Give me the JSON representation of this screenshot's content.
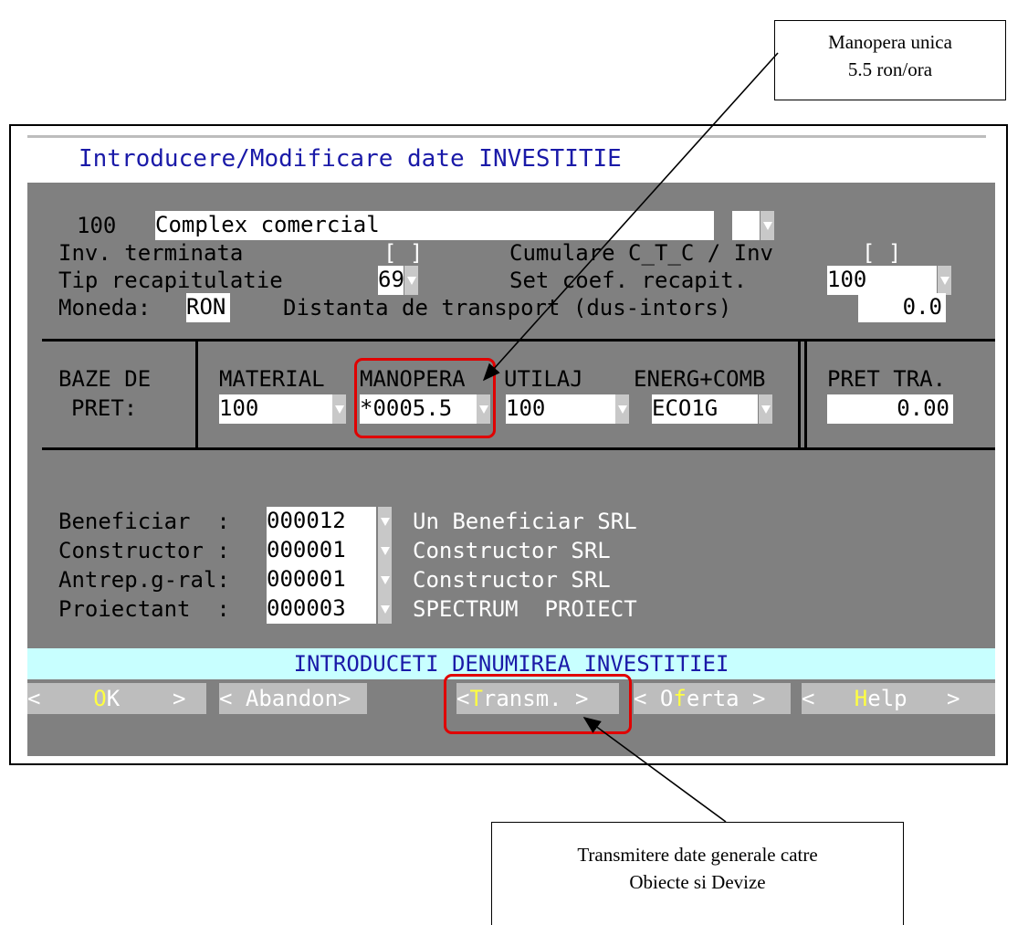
{
  "callouts": {
    "top": {
      "line1": "Manopera unica",
      "line2": "5.5 ron/ora"
    },
    "bottom": {
      "line1": "Transmitere date generale catre",
      "line2": "Obiecte si Devize"
    }
  },
  "window": {
    "title": "Introducere/Modificare date INVESTITIE",
    "investment": {
      "code": "100",
      "name": "Complex comercial"
    },
    "labels": {
      "inv_terminata": "Inv. terminata",
      "cumulare": "Cumulare C_T_C / Inv",
      "tip_recap": "Tip recapitulatie",
      "set_coef": "Set coef. recapit.",
      "moneda": "Moneda:",
      "distanta": "Distanta de transport (dus-intors)"
    },
    "values": {
      "inv_terminata": "[ ]",
      "cumulare": "[ ]",
      "tip_recap": "69",
      "set_coef": "100",
      "moneda": "RON",
      "distanta": "0.0"
    },
    "price_bases": {
      "label_line1": "BAZE DE",
      "label_line2": "PRET:",
      "material": {
        "header": "MATERIAL",
        "value": "100"
      },
      "manopera": {
        "header": "MANOPERA",
        "value": "*0005.5"
      },
      "utilaj": {
        "header": "UTILAJ",
        "value": "100"
      },
      "energ": {
        "header": "ENERG+COMB",
        "value": "ECO1G"
      },
      "pret_tra": {
        "header": "PRET TRA.",
        "value": "0.00"
      }
    },
    "parties": [
      {
        "label": "Beneficiar  :",
        "code": "000012",
        "name": "Un Beneficiar SRL"
      },
      {
        "label": "Constructor :",
        "code": "000001",
        "name": "Constructor SRL"
      },
      {
        "label": "Antrep.g-ral:",
        "code": "000001",
        "name": "Constructor SRL"
      },
      {
        "label": "Proiectant  :",
        "code": "000003",
        "name": "SPECTRUM  PROIECT"
      }
    ],
    "message": "INTRODUCETI DENUMIREA INVESTITIEI",
    "buttons": {
      "ok": {
        "pre": "<    ",
        "hot": "O",
        "post": "K    >"
      },
      "abandon": {
        "text": "< Abandon>"
      },
      "transm": {
        "pre": "<",
        "hot": "T",
        "post": "ransm. >"
      },
      "oferta": {
        "pre": "< O",
        "hot": "f",
        "post": "erta >"
      },
      "help": {
        "pre": "<   ",
        "hot": "H",
        "post": "elp   >"
      }
    }
  }
}
